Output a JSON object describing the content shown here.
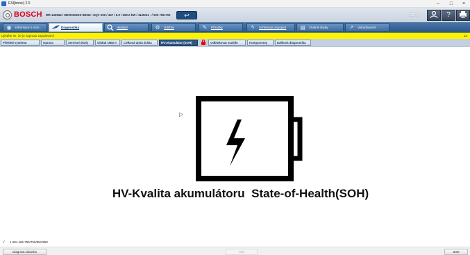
{
  "window": {
    "title": "ESI[tronic] 2.0",
    "minimize": "–",
    "maximize": "□",
    "close": "×"
  },
  "header": {
    "brand": "BOSCH",
    "vehicle_info": "MR 132834 / MERCEDES-BENZ / EQV 250 / 447 / 6.0 / 150.0 kW / 11/2021 - / 000 789.702",
    "back_symbol": "↩",
    "mode_label": "DEMO",
    "icons": [
      "user-icon",
      "help-icon",
      "print-icon"
    ]
  },
  "main_tabs": [
    {
      "label": "Informace o vozi...",
      "icon": "car-info-icon",
      "active": false
    },
    {
      "label": "Diagnostika",
      "icon": "diagnostics-icon",
      "active": true
    },
    {
      "label": "Hledání",
      "icon": "search-icon",
      "active": false
    },
    {
      "label": "Údržba",
      "icon": "maintenance-icon",
      "active": false
    },
    {
      "label": "Příručky",
      "icon": "wrench-icon",
      "active": false
    },
    {
      "label": "Schémata zapojení",
      "icon": "wiring-icon",
      "active": false
    },
    {
      "label": "Známé chyby",
      "icon": "known-errors-icon",
      "active": false
    },
    {
      "label": "Vyhodnocení",
      "icon": "evaluation-icon",
      "active": false
    }
  ],
  "info_bar": {
    "message": "Ujistěte se, že je zapnuto zapalování!",
    "counter": "12"
  },
  "sub_tabs": [
    {
      "label": "Přehled systému",
      "active": false
    },
    {
      "label": "Oprava",
      "active": false
    },
    {
      "label": "Servisní úkoly",
      "active": false
    },
    {
      "label": "Global OBD II",
      "active": false
    },
    {
      "label": "Celková ujetá dráha",
      "active": false
    },
    {
      "label": "HV-Akumulátor (SOH)",
      "active": true
    },
    {
      "label": "Odblokovat vozidlo",
      "active": false,
      "locked": true
    },
    {
      "label": "Komponenty",
      "active": false
    },
    {
      "label": "Dálková diagnostika",
      "active": false
    }
  ],
  "content": {
    "graphic": "hv-battery-icon",
    "caption": "HV-Kvalita akumulátoru  State-of-Health(SOH)"
  },
  "status": {
    "version": "1 684 465 755/756/881/882"
  },
  "footer": {
    "left_button": "Diagnost.zásuvka",
    "middle_button": "Test",
    "right_button": "Start"
  }
}
